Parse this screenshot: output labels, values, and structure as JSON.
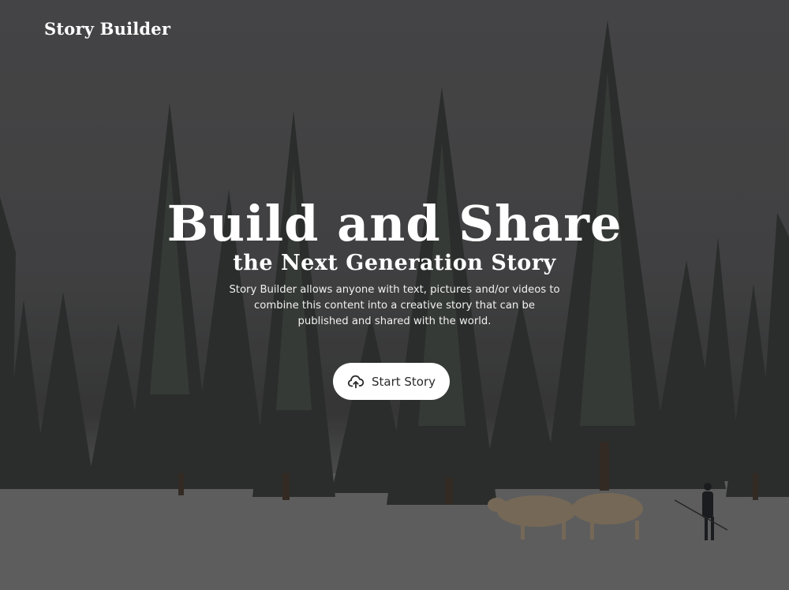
{
  "header": {
    "brand": "Story Builder"
  },
  "hero": {
    "headline": "Build and Share",
    "subheadline": "the Next Generation Story",
    "description": "Story Builder allows anyone with text, pictures and/or videos to combine this content into a creative story that can be published and shared with the world.",
    "cta": {
      "label": "Start Story",
      "icon": "cloud-upload-icon"
    }
  },
  "colors": {
    "overlay": "#4e4e50",
    "button_bg": "#ffffff",
    "button_text": "#2b2b2b",
    "text": "#ffffff"
  }
}
